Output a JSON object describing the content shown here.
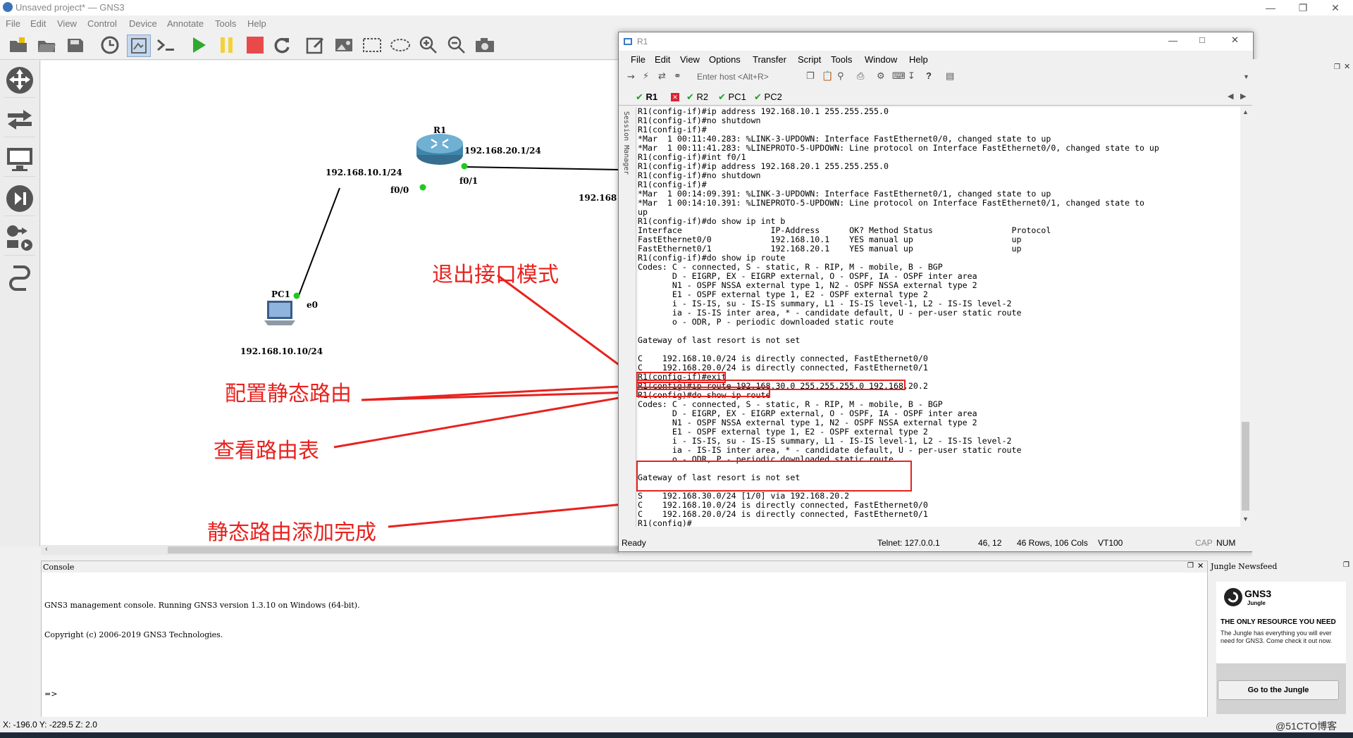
{
  "app": {
    "title": "Unsaved project* — GNS3"
  },
  "menu": [
    "File",
    "Edit",
    "View",
    "Control",
    "Device",
    "Annotate",
    "Tools",
    "Help"
  ],
  "topology": {
    "r1_label": "R1",
    "pc1_label": "PC1",
    "r1_ip_left": "192.168.10.1/24",
    "r1_ip_right": "192.168.20.1/24",
    "if_f00": "f0/0",
    "if_f01": "f0/1",
    "ip_partial": "192.168",
    "pc_if": "e0",
    "pc_ip": "192.168.10.10/24"
  },
  "annotations": {
    "exit_iface": "退出接口模式",
    "config_route": "配置静态路由",
    "show_route": "查看路由表",
    "route_done": "静态路由添加完成"
  },
  "terminal": {
    "title": "R1",
    "menu": [
      "File",
      "Edit",
      "View",
      "Options",
      "Transfer",
      "Script",
      "Tools",
      "Window",
      "Help"
    ],
    "host_placeholder": "Enter host <Alt+R>",
    "tabs": [
      "R1",
      "R2",
      "PC1",
      "PC2"
    ],
    "session_manager": "Session Manager",
    "lines": [
      "R1(config-if)#ip address 192.168.10.1 255.255.255.0",
      "R1(config-if)#no shutdown",
      "R1(config-if)#",
      "*Mar  1 00:11:40.283: %LINK-3-UPDOWN: Interface FastEthernet0/0, changed state to up",
      "*Mar  1 00:11:41.283: %LINEPROTO-5-UPDOWN: Line protocol on Interface FastEthernet0/0, changed state to up",
      "R1(config-if)#int f0/1",
      "R1(config-if)#ip address 192.168.20.1 255.255.255.0",
      "R1(config-if)#no shutdown",
      "R1(config-if)#",
      "*Mar  1 00:14:09.391: %LINK-3-UPDOWN: Interface FastEthernet0/1, changed state to up",
      "*Mar  1 00:14:10.391: %LINEPROTO-5-UPDOWN: Line protocol on Interface FastEthernet0/1, changed state to",
      "up",
      "R1(config-if)#do show ip int b",
      "Interface                  IP-Address      OK? Method Status                Protocol",
      "FastEthernet0/0            192.168.10.1    YES manual up                    up",
      "FastEthernet0/1            192.168.20.1    YES manual up                    up",
      "R1(config-if)#do show ip route",
      "Codes: C - connected, S - static, R - RIP, M - mobile, B - BGP",
      "       D - EIGRP, EX - EIGRP external, O - OSPF, IA - OSPF inter area",
      "       N1 - OSPF NSSA external type 1, N2 - OSPF NSSA external type 2",
      "       E1 - OSPF external type 1, E2 - OSPF external type 2",
      "       i - IS-IS, su - IS-IS summary, L1 - IS-IS level-1, L2 - IS-IS level-2",
      "       ia - IS-IS inter area, * - candidate default, U - per-user static route",
      "       o - ODR, P - periodic downloaded static route",
      "",
      "Gateway of last resort is not set",
      "",
      "C    192.168.10.0/24 is directly connected, FastEthernet0/0",
      "C    192.168.20.0/24 is directly connected, FastEthernet0/1",
      "R1(config-if)#exit",
      "R1(config)#ip route 192.168.30.0 255.255.255.0 192.168.20.2",
      "R1(config)#do show ip route",
      "Codes: C - connected, S - static, R - RIP, M - mobile, B - BGP",
      "       D - EIGRP, EX - EIGRP external, O - OSPF, IA - OSPF inter area",
      "       N1 - OSPF NSSA external type 1, N2 - OSPF NSSA external type 2",
      "       E1 - OSPF external type 1, E2 - OSPF external type 2",
      "       i - IS-IS, su - IS-IS summary, L1 - IS-IS level-1, L2 - IS-IS level-2",
      "       ia - IS-IS inter area, * - candidate default, U - per-user static route",
      "       o - ODR, P - periodic downloaded static route",
      "",
      "Gateway of last resort is not set",
      "",
      "S    192.168.30.0/24 [1/0] via 192.168.20.2",
      "C    192.168.10.0/24 is directly connected, FastEthernet0/0",
      "C    192.168.20.0/24 is directly connected, FastEthernet0/1",
      "R1(config)#"
    ],
    "status": {
      "ready": "Ready",
      "telnet": "Telnet: 127.0.0.1",
      "pos": "46,  12",
      "size": "46 Rows, 106 Cols",
      "vt": "VT100",
      "cap": "CAP",
      "num": "NUM"
    }
  },
  "console": {
    "title": "Console",
    "lines": [
      "GNS3 management console. Running GNS3 version 1.3.10 on Windows (64-bit).",
      "Copyright (c) 2006-2019 GNS3 Technologies.",
      "",
      "=>"
    ]
  },
  "jungle": {
    "title": "Jungle Newsfeed",
    "logo": "GNS3",
    "logo_sub": "Jungle",
    "headline": "THE ONLY RESOURCE YOU NEED",
    "body": "The Jungle has everything you will ever need for GNS3. Come check it out now.",
    "button": "Go to the Jungle"
  },
  "statusbar": {
    "coords": "X: -196.0 Y: -229.5 Z: 2.0",
    "watermark": "@51CTO博客"
  }
}
